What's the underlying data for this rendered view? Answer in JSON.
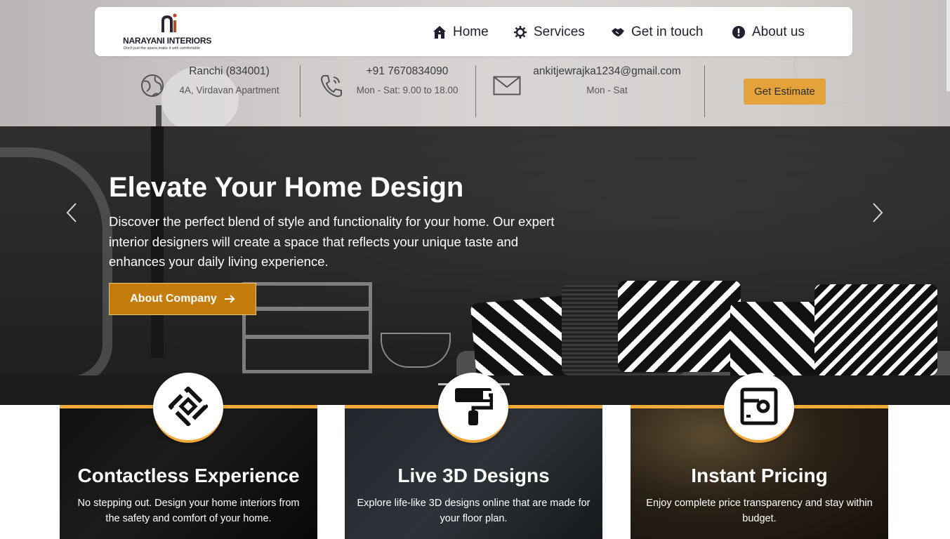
{
  "brand": {
    "name": "NARAYANI INTERIORS",
    "tagline": "Don't just the space,make it with comfortable",
    "accent_color": "#e4a23a"
  },
  "nav": {
    "items": [
      {
        "label": "Home",
        "icon": "home-icon"
      },
      {
        "label": "Services",
        "icon": "gear-icon"
      },
      {
        "label": "Get in touch",
        "icon": "handshake-icon"
      },
      {
        "label": "About us",
        "icon": "info-icon"
      }
    ]
  },
  "info": {
    "location": {
      "line1": "Ranchi (834001)",
      "line2": "4A, Virdavan Apartment",
      "icon": "globe-icon"
    },
    "phone": {
      "line1": "+91 7670834090",
      "line2": "Mon - Sat: 9.00 to 18.00",
      "icon": "phone-icon"
    },
    "email": {
      "line1": "ankitjewrajka1234@gmail.com",
      "line2": "Mon - Sat",
      "icon": "mail-icon"
    },
    "estimate_label": "Get Estimate"
  },
  "hero": {
    "title": "Elevate Your Home Design",
    "description": "Discover the perfect blend of style and functionality for your home. Our expert interior designers will create a space that reflects your unique taste and enhances your daily living experience.",
    "button_label": "About Company"
  },
  "features": [
    {
      "title": "Contactless Experience",
      "description": "No stepping out. Design your home interiors from the safety and comfort of your home.",
      "icon": "diamond-target-icon"
    },
    {
      "title": "Live 3D Designs",
      "description": "Explore life-like 3D designs online that are made for your floor plan.",
      "icon": "paint-roller-icon"
    },
    {
      "title": "Instant Pricing",
      "description": "Enjoy complete price transparency and stay within budget.",
      "icon": "price-tag-icon"
    }
  ]
}
